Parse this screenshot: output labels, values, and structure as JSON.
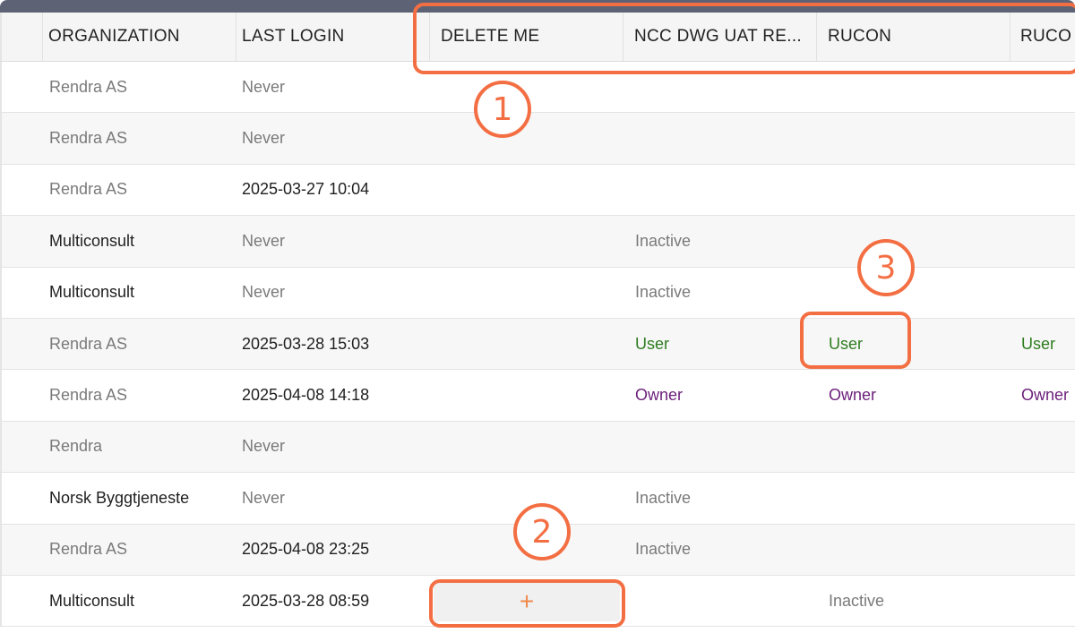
{
  "columns": [
    {
      "label": ""
    },
    {
      "label": "ORGANIZATION"
    },
    {
      "label": "LAST LOGIN"
    },
    {
      "label": "DELETE ME"
    },
    {
      "label": "NCC DWG UAT RE..."
    },
    {
      "label": "RUCON"
    },
    {
      "label": "RUCO"
    }
  ],
  "rows": [
    {
      "org": "Rendra AS",
      "org_style": "muted",
      "login": "Never",
      "login_style": "muted",
      "delete_me": "",
      "ncc": "",
      "rucon": "",
      "ruco": ""
    },
    {
      "org": "Rendra AS",
      "org_style": "muted",
      "login": "Never",
      "login_style": "muted",
      "delete_me": "",
      "ncc": "",
      "rucon": "",
      "ruco": ""
    },
    {
      "org": "Rendra AS",
      "org_style": "muted",
      "login": "2025-03-27 10:04",
      "login_style": "dark",
      "delete_me": "",
      "ncc": "",
      "rucon": "",
      "ruco": ""
    },
    {
      "org": "Multiconsult",
      "org_style": "dark",
      "login": "Never",
      "login_style": "muted",
      "delete_me": "",
      "ncc": "Inactive",
      "rucon": "",
      "ruco": ""
    },
    {
      "org": "Multiconsult",
      "org_style": "dark",
      "login": "Never",
      "login_style": "muted",
      "delete_me": "",
      "ncc": "Inactive",
      "rucon": "",
      "ruco": ""
    },
    {
      "org": "Rendra AS",
      "org_style": "muted",
      "login": "2025-03-28 15:03",
      "login_style": "dark",
      "delete_me": "",
      "ncc": "User",
      "rucon": "User",
      "ruco": "User"
    },
    {
      "org": "Rendra AS",
      "org_style": "muted",
      "login": "2025-04-08 14:18",
      "login_style": "dark",
      "delete_me": "",
      "ncc": "Owner",
      "rucon": "Owner",
      "ruco": "Owner"
    },
    {
      "org": "Rendra",
      "org_style": "muted",
      "login": "Never",
      "login_style": "muted",
      "delete_me": "",
      "ncc": "",
      "rucon": "",
      "ruco": ""
    },
    {
      "org": "Norsk Byggtjeneste",
      "org_style": "dark",
      "login": "Never",
      "login_style": "muted",
      "delete_me": "",
      "ncc": "Inactive",
      "rucon": "",
      "ruco": ""
    },
    {
      "org": "Rendra AS",
      "org_style": "muted",
      "login": "2025-04-08 23:25",
      "login_style": "dark",
      "delete_me": "",
      "ncc": "Inactive",
      "rucon": "",
      "ruco": ""
    },
    {
      "org": "Multiconsult",
      "org_style": "dark",
      "login": "2025-03-28 08:59",
      "login_style": "dark",
      "delete_me": "",
      "ncc": "",
      "rucon": "Inactive",
      "ruco": ""
    }
  ],
  "add_button": {
    "symbol": "+"
  },
  "annotations": [
    {
      "number": "1"
    },
    {
      "number": "2"
    },
    {
      "number": "3"
    }
  ],
  "colors": {
    "accent": "#f36f43",
    "role_user": "#2e7d1f",
    "role_owner": "#6b1f7a",
    "muted_text": "#7a7a7a",
    "header_bar": "#5d6274"
  }
}
